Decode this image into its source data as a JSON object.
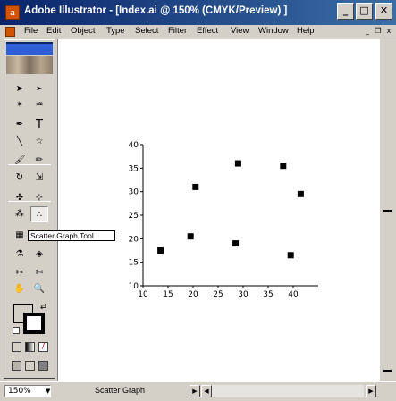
{
  "window": {
    "title": "Adobe Illustrator - [Index.ai @ 150% (CMYK/Preview) ]",
    "app_icon_glyph": "a",
    "controls": {
      "minimize": "_",
      "maximize": "□",
      "close": "✕"
    }
  },
  "menubar": {
    "items": [
      "File",
      "Edit",
      "Object",
      "Type",
      "Select",
      "Filter",
      "Effect",
      "View",
      "Window",
      "Help"
    ],
    "doc_controls": {
      "minimize": "_",
      "restore": "❐",
      "close": "x"
    }
  },
  "toolbox": {
    "tools": [
      {
        "name": "selection-tool-icon",
        "glyph": "➤"
      },
      {
        "name": "direct-selection-tool-icon",
        "glyph": "➢"
      },
      {
        "name": "magic-wand-tool-icon",
        "glyph": "✴"
      },
      {
        "name": "lasso-tool-icon",
        "glyph": "♒"
      },
      {
        "name": "pen-tool-icon",
        "glyph": "✒"
      },
      {
        "name": "type-tool-icon",
        "glyph": "T"
      },
      {
        "name": "line-segment-tool-icon",
        "glyph": "╲"
      },
      {
        "name": "star-tool-icon",
        "glyph": "☆"
      },
      {
        "name": "paintbrush-tool-icon",
        "glyph": "🖌"
      },
      {
        "name": "pencil-tool-icon",
        "glyph": "✏"
      },
      {
        "name": "rotate-tool-icon",
        "glyph": "↻"
      },
      {
        "name": "scale-tool-icon",
        "glyph": "⇲"
      },
      {
        "name": "warp-tool-icon",
        "glyph": "✣"
      },
      {
        "name": "free-transform-tool-icon",
        "glyph": "⊹"
      },
      {
        "name": "symbol-sprayer-tool-icon",
        "glyph": "⁂"
      },
      {
        "name": "scatter-graph-tool-icon",
        "glyph": "∴"
      },
      {
        "name": "mesh-tool-icon",
        "glyph": "▦"
      },
      {
        "name": "gradient-tool-icon",
        "glyph": "▤"
      },
      {
        "name": "eyedropper-tool-icon",
        "glyph": "⚗"
      },
      {
        "name": "blend-tool-icon",
        "glyph": "◈"
      },
      {
        "name": "slice-tool-icon",
        "glyph": "✂"
      },
      {
        "name": "scissors-tool-icon",
        "glyph": "✄"
      },
      {
        "name": "hand-tool-icon",
        "glyph": "✋"
      },
      {
        "name": "zoom-tool-icon",
        "glyph": "🔍"
      }
    ],
    "active_tool": "scatter-graph-tool-icon"
  },
  "tooltip": {
    "text": "Scatter Graph Tool"
  },
  "status": {
    "zoom": "150%",
    "zoom_arrow": "▼",
    "current_tool": "Scatter Graph",
    "arrow_right": "▶",
    "arrow_left": "◀"
  },
  "colors": {
    "titlebar_start": "#0a246a",
    "titlebar_end": "#3a6ea5",
    "face": "#d4d0c8",
    "canvas": "#ffffff",
    "marker": "#000000"
  },
  "chart_data": {
    "type": "scatter",
    "title": "",
    "xlabel": "",
    "ylabel": "",
    "xlim": [
      10,
      45
    ],
    "ylim": [
      10,
      40
    ],
    "x_ticks": [
      10,
      15,
      20,
      25,
      30,
      35,
      40
    ],
    "y_ticks": [
      10,
      15,
      20,
      25,
      30,
      35,
      40
    ],
    "grid": false,
    "points": [
      {
        "x": 13.5,
        "y": 17.5
      },
      {
        "x": 19.5,
        "y": 20.5
      },
      {
        "x": 20.5,
        "y": 31.0
      },
      {
        "x": 28.5,
        "y": 19.0
      },
      {
        "x": 29.0,
        "y": 36.0
      },
      {
        "x": 38.0,
        "y": 35.5
      },
      {
        "x": 39.5,
        "y": 16.5
      },
      {
        "x": 41.5,
        "y": 29.5
      }
    ]
  }
}
